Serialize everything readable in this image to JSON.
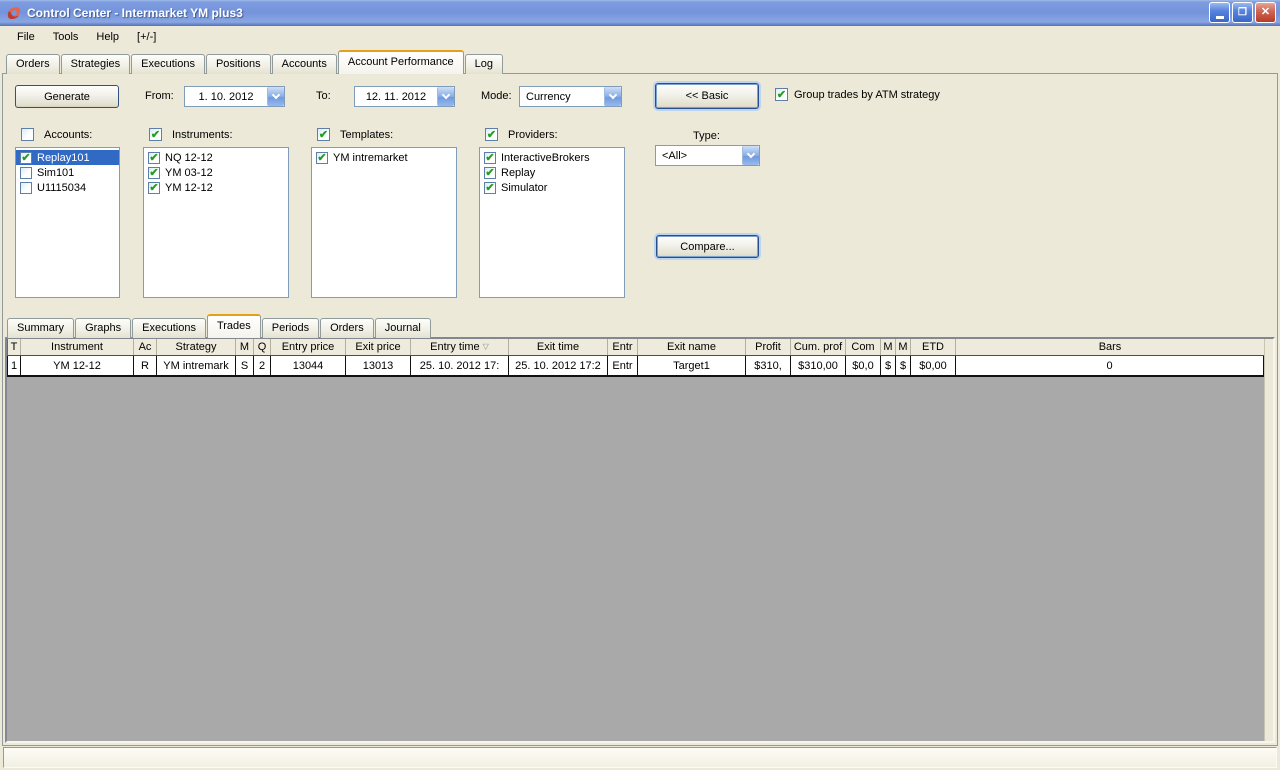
{
  "window": {
    "title": "Control Center - Intermarket YM plus3",
    "buttons": {
      "minimize": "minimize",
      "restore": "restore",
      "close": "close"
    }
  },
  "menu": {
    "items": [
      "File",
      "Tools",
      "Help",
      "[+/-]"
    ]
  },
  "main_tabs": {
    "items": [
      {
        "label": "Orders",
        "active": false
      },
      {
        "label": "Strategies",
        "active": false
      },
      {
        "label": "Executions",
        "active": false
      },
      {
        "label": "Positions",
        "active": false
      },
      {
        "label": "Accounts",
        "active": false
      },
      {
        "label": "Account Performance",
        "active": true
      },
      {
        "label": "Log",
        "active": false
      }
    ]
  },
  "toolbar": {
    "generate_label": "Generate",
    "from_label": "From:",
    "from_value": "1. 10. 2012",
    "to_label": "To:",
    "to_value": "12. 11. 2012",
    "mode_label": "Mode:",
    "mode_value": "Currency",
    "basic_label": "<< Basic",
    "group_checkbox_label": "Group trades by ATM strategy",
    "group_checked": true
  },
  "filters": {
    "accounts": {
      "label": "Accounts:",
      "checked": false,
      "items": [
        {
          "label": "Replay101",
          "checked": true,
          "selected": true
        },
        {
          "label": "Sim101",
          "checked": false,
          "selected": false
        },
        {
          "label": "U1115034",
          "checked": false,
          "selected": false
        }
      ]
    },
    "instruments": {
      "label": "Instruments:",
      "checked": true,
      "items": [
        {
          "label": "NQ 12-12",
          "checked": true,
          "selected": false
        },
        {
          "label": "YM 03-12",
          "checked": true,
          "selected": false
        },
        {
          "label": "YM 12-12",
          "checked": true,
          "selected": false
        }
      ]
    },
    "templates": {
      "label": "Templates:",
      "checked": true,
      "items": [
        {
          "label": "YM intremarket",
          "checked": true,
          "selected": false
        }
      ]
    },
    "providers": {
      "label": "Providers:",
      "checked": true,
      "items": [
        {
          "label": "InteractiveBrokers",
          "checked": true,
          "selected": false
        },
        {
          "label": "Replay",
          "checked": true,
          "selected": false
        },
        {
          "label": "Simulator",
          "checked": true,
          "selected": false
        }
      ]
    },
    "type": {
      "label": "Type:",
      "value": "<All>"
    },
    "compare_label": "Compare..."
  },
  "sub_tabs": {
    "items": [
      {
        "label": "Summary",
        "active": false
      },
      {
        "label": "Graphs",
        "active": false
      },
      {
        "label": "Executions",
        "active": false
      },
      {
        "label": "Trades",
        "active": true
      },
      {
        "label": "Periods",
        "active": false
      },
      {
        "label": "Orders",
        "active": false
      },
      {
        "label": "Journal",
        "active": false
      }
    ]
  },
  "trades_table": {
    "columns": [
      "T",
      "Instrument",
      "Ac",
      "Strategy",
      "M",
      "Q",
      "Entry price",
      "Exit price",
      "Entry time",
      "Exit time",
      "Entr",
      "Exit name",
      "Profit",
      "Cum. prof",
      "Com",
      "M",
      "M",
      "ETD",
      "Bars"
    ],
    "sort_column": "Entry time",
    "rows": [
      [
        "1",
        "YM 12-12",
        "R",
        "YM intremark",
        "S",
        "2",
        "13044",
        "13013",
        "25. 10. 2012 17:",
        "25. 10. 2012 17:2",
        "Entr",
        "Target1",
        "$310,",
        "$310,00",
        "$0,0",
        "$",
        "$",
        "$0,00",
        "0"
      ]
    ]
  },
  "colors": {
    "titlebar_blue": "#7493da",
    "active_tab_accent": "#e5a01a",
    "selection_blue": "#316ac5",
    "check_green": "#21a121",
    "grid_empty_gray": "#a9a9a9",
    "window_beige": "#ece9d8"
  }
}
